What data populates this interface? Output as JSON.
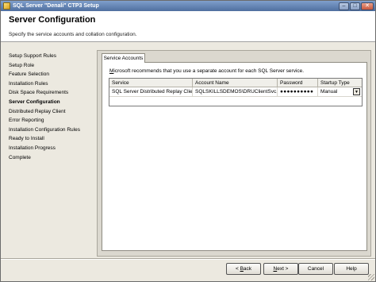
{
  "window": {
    "title": "SQL Server \"Denali\" CTP3 Setup",
    "controls": {
      "minimize": "–",
      "maximize": "□",
      "close": "✕"
    }
  },
  "header": {
    "title": "Server Configuration",
    "subtitle": "Specify the service accounts and collation configuration."
  },
  "nav": {
    "items": [
      {
        "label": "Setup Support Rules"
      },
      {
        "label": "Setup Role"
      },
      {
        "label": "Feature Selection"
      },
      {
        "label": "Installation Rules"
      },
      {
        "label": "Disk Space Requirements"
      },
      {
        "label": "Server Configuration"
      },
      {
        "label": "Distributed Replay Client"
      },
      {
        "label": "Error Reporting"
      },
      {
        "label": "Installation Configuration Rules"
      },
      {
        "label": "Ready to Install"
      },
      {
        "label": "Installation Progress"
      },
      {
        "label": "Complete"
      }
    ],
    "active_label": "Server Configuration"
  },
  "tabs": {
    "service_accounts": "Service Accounts"
  },
  "info": {
    "prefix": "M",
    "text": "icrosoft recommends that you use a separate account for each SQL Server service."
  },
  "grid": {
    "headers": {
      "service": "Service",
      "account_name": "Account Name",
      "password": "Password",
      "startup_type": "Startup Type"
    },
    "rows": [
      {
        "service": "SQL Server Distributed Replay Client",
        "account_name": "SQLSKILLSDEMOS\\DRUClientSvc...",
        "password": "●●●●●●●●●●",
        "startup_type": "Manual"
      }
    ]
  },
  "buttons": {
    "back": {
      "prefix": "< ",
      "accel": "B",
      "rest": "ack"
    },
    "next": {
      "accel": "N",
      "rest": "ext >"
    },
    "cancel": "Cancel",
    "help": "Help"
  },
  "icons": {
    "dropdown": "▼"
  }
}
